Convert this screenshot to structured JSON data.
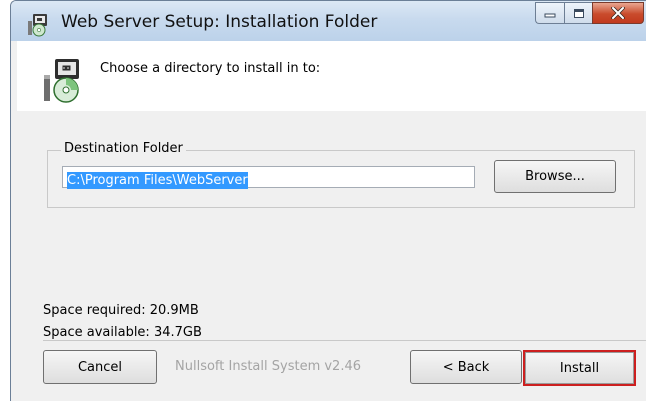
{
  "window": {
    "title": "Web Server Setup: Installation Folder",
    "icon": "installer-icon",
    "controls": {
      "minimize": "minimize-icon",
      "maximize": "maximize-icon",
      "close": "close-icon"
    }
  },
  "header": {
    "instruction": "Choose a directory to install in to:",
    "icon": "installer-disc-icon"
  },
  "destination": {
    "group_label": "Destination Folder",
    "path": "C:\\Program Files\\WebServer",
    "browse_label": "Browse..."
  },
  "space": {
    "required": "Space required: 20.9MB",
    "available": "Space available: 34.7GB"
  },
  "footer": {
    "branding": "Nullsoft Install System v2.46",
    "cancel_label": "Cancel",
    "back_label": "< Back",
    "install_label": "Install"
  },
  "colors": {
    "selection": "#3399ff",
    "highlight_border": "#cc1f1f",
    "close_button": "#c94b2c"
  }
}
